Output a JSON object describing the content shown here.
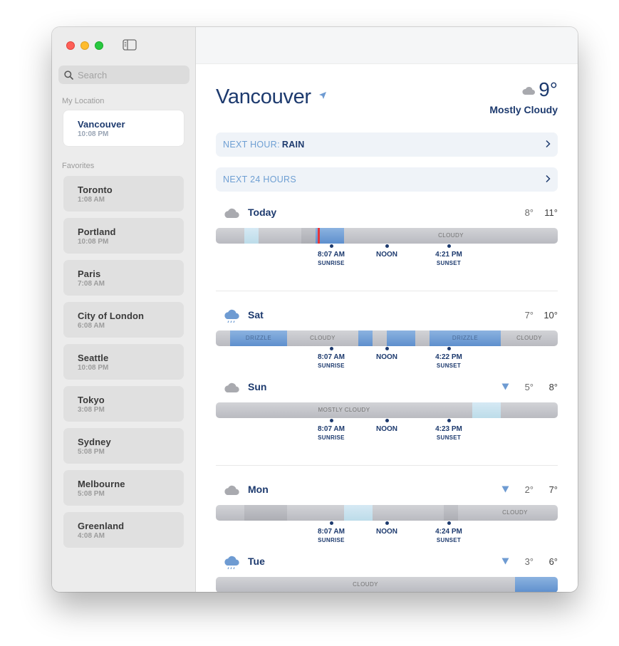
{
  "sidebar": {
    "search_placeholder": "Search",
    "my_location_label": "My Location",
    "favorites_label": "Favorites",
    "current": {
      "name": "Vancouver",
      "time": "10:08 PM"
    },
    "favorites": [
      {
        "name": "Toronto",
        "time": "1:08 AM"
      },
      {
        "name": "Portland",
        "time": "10:08 PM"
      },
      {
        "name": "Paris",
        "time": "7:08 AM"
      },
      {
        "name": "City of London",
        "time": "6:08 AM"
      },
      {
        "name": "Seattle",
        "time": "10:08 PM"
      },
      {
        "name": "Tokyo",
        "time": "3:08 PM"
      },
      {
        "name": "Sydney",
        "time": "5:08 PM"
      },
      {
        "name": "Melbourne",
        "time": "5:08 PM"
      },
      {
        "name": "Greenland",
        "time": "4:08 AM"
      }
    ]
  },
  "main": {
    "city": "Vancouver",
    "current_temp": "9°",
    "condition": "Mostly Cloudy",
    "next_hour": {
      "label": "NEXT HOUR:",
      "value": "RAIN"
    },
    "next_24": {
      "label": "NEXT 24 HOURS"
    },
    "days": [
      {
        "name": "Today",
        "lo": "8°",
        "hi": "11°",
        "icon": "cloud-icon",
        "bar_label": "CLOUDY",
        "sunrise": "8:07 AM",
        "noon": "NOON",
        "sunset": "4:21 PM"
      },
      {
        "name": "Sat",
        "lo": "7°",
        "hi": "10°",
        "icon": "rain-cloud-icon",
        "bar_labels": [
          "DRIZZLE",
          "CLOUDY",
          "DRIZZLE",
          "CLOUDY"
        ],
        "sunrise": "8:07 AM",
        "noon": "NOON",
        "sunset": "4:22 PM"
      },
      {
        "name": "Sun",
        "lo": "5°",
        "hi": "8°",
        "icon": "cloud-icon",
        "bar_label": "MOSTLY CLOUDY",
        "sunrise": "8:07 AM",
        "noon": "NOON",
        "sunset": "4:23 PM"
      },
      {
        "name": "Mon",
        "lo": "2°",
        "hi": "7°",
        "icon": "cloud-icon",
        "bar_label": "CLOUDY",
        "sunrise": "8:07 AM",
        "noon": "NOON",
        "sunset": "4:24 PM"
      },
      {
        "name": "Tue",
        "lo": "3°",
        "hi": "6°",
        "icon": "rain-cloud-icon",
        "bar_label": "CLOUDY"
      }
    ],
    "sunrise_label": "SUNRISE",
    "sunset_label": "SUNSET"
  },
  "colors": {
    "accent": "#1d3a6e",
    "drizzle": "#6e9bd2",
    "light_blue": "#c8e3ee",
    "now": "#e5353a"
  }
}
